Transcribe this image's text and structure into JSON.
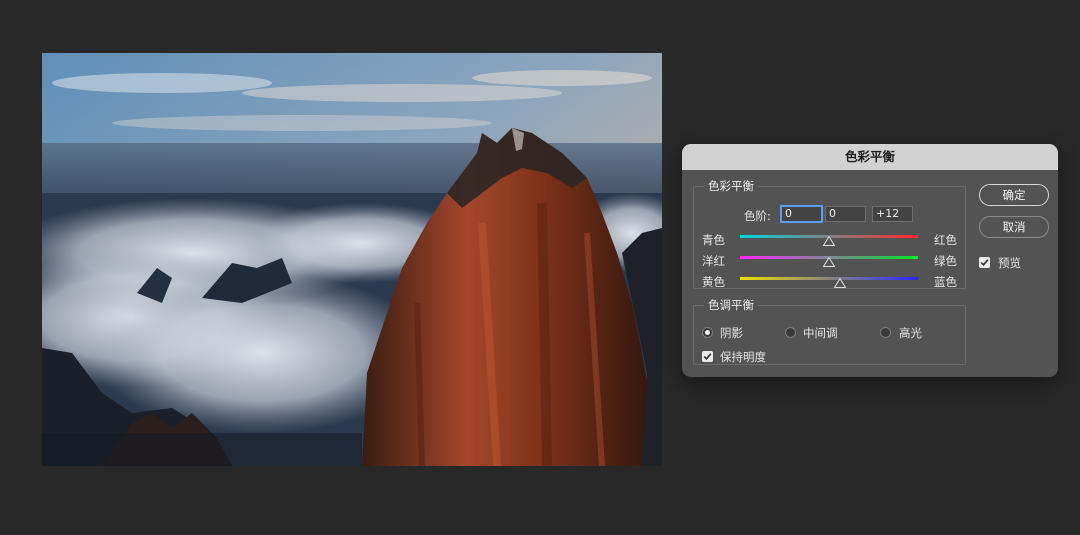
{
  "dialog": {
    "title": "色彩平衡",
    "color_balance": {
      "legend": "色彩平衡",
      "levels_label": "色阶:",
      "levels": [
        "0",
        "0",
        "+12"
      ],
      "sliders": [
        {
          "left": "青色",
          "right": "红色",
          "value": 0
        },
        {
          "left": "洋红",
          "right": "绿色",
          "value": 0
        },
        {
          "left": "黄色",
          "right": "蓝色",
          "value": 12
        }
      ]
    },
    "tone_balance": {
      "legend": "色调平衡",
      "options": [
        "阴影",
        "中间调",
        "高光"
      ],
      "selected": "阴影",
      "preserve_luminosity_label": "保持明度",
      "preserve_luminosity": true
    },
    "buttons": {
      "ok": "确定",
      "cancel": "取消"
    },
    "preview_label": "预览",
    "preview": true,
    "colors": {
      "title_bar": "#d2d2d2",
      "panel": "#535353",
      "focus": "#5b9df0"
    }
  },
  "canvas": {
    "background": "#282828"
  }
}
